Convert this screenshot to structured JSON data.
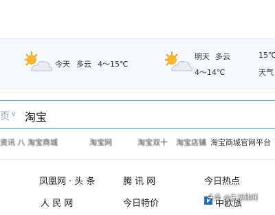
{
  "weather": {
    "today": {
      "day": "今天",
      "condition": "多云",
      "temp": "4～15℃",
      "icon": "partly-cloudy-icon"
    },
    "tomorrow": {
      "day": "明天",
      "condition": "多云",
      "temp": "4～14℃",
      "icon": "partly-cloudy-icon"
    },
    "third": {
      "temp_partial": "15℃",
      "label_partial": "天气"
    }
  },
  "search": {
    "scope_label": "页",
    "query": "淘宝"
  },
  "suggestions": [
    "资讯 八 淘宝商城",
    "淘宝网",
    "淘宝双十",
    "淘宝店铺",
    "淘宝商城官网平台"
  ],
  "links": {
    "col1": [
      "凤凰网 · 头 条",
      "人 民 网"
    ],
    "col2": [
      "腾 讯 网",
      "今日特价"
    ],
    "col3": [
      "今日热点",
      "中欧旅"
    ]
  },
  "watermark": "头条 @生活趣闻"
}
